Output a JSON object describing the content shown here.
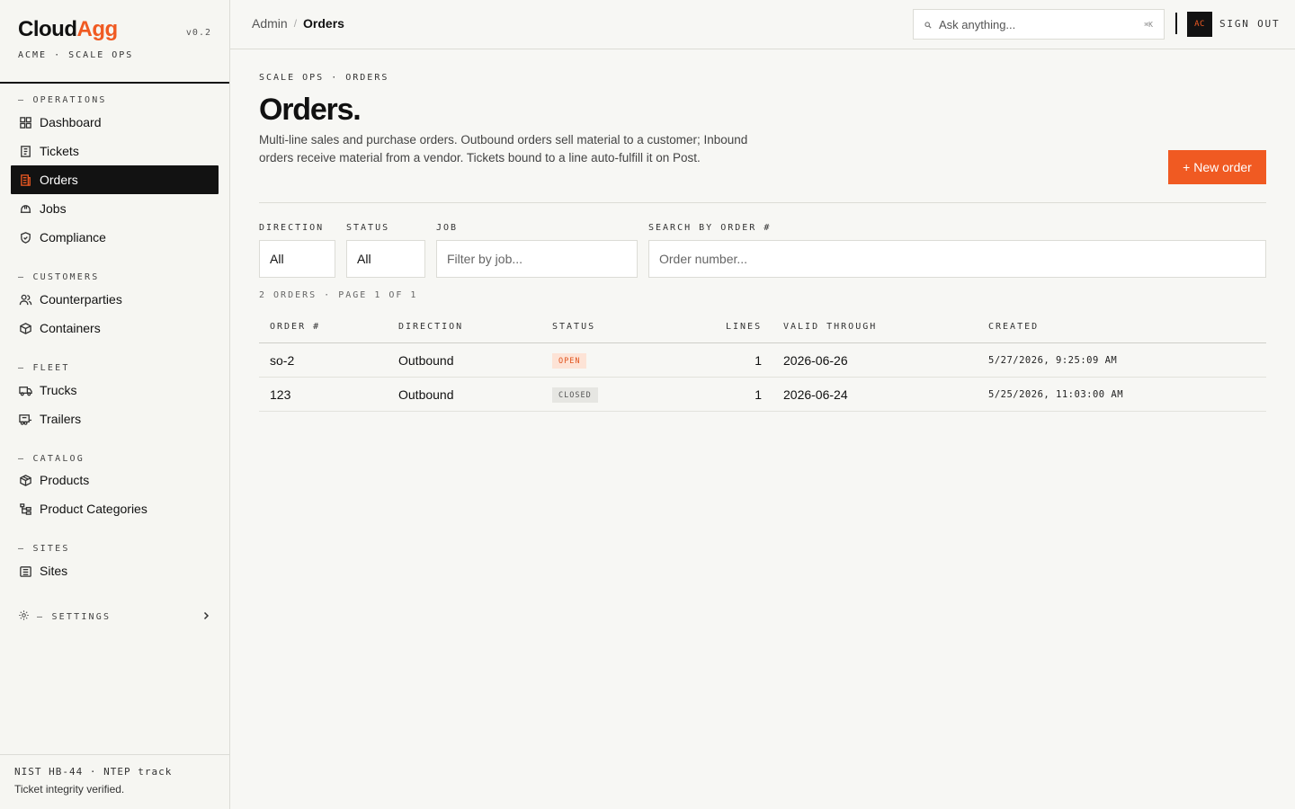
{
  "app": {
    "logo_part1": "Cloud",
    "logo_part2": "Agg",
    "version": "v0.2",
    "org": "ACME · SCALE OPS"
  },
  "sidebar": {
    "sections": [
      {
        "label": "— OPERATIONS",
        "items": [
          {
            "label": "Dashboard",
            "icon": "grid-icon"
          },
          {
            "label": "Tickets",
            "icon": "ticket-icon"
          },
          {
            "label": "Orders",
            "icon": "orders-icon",
            "active": true
          },
          {
            "label": "Jobs",
            "icon": "hardhat-icon"
          },
          {
            "label": "Compliance",
            "icon": "shield-icon"
          }
        ]
      },
      {
        "label": "— CUSTOMERS",
        "items": [
          {
            "label": "Counterparties",
            "icon": "users-icon"
          },
          {
            "label": "Containers",
            "icon": "box-icon"
          }
        ]
      },
      {
        "label": "— FLEET",
        "items": [
          {
            "label": "Trucks",
            "icon": "truck-icon"
          },
          {
            "label": "Trailers",
            "icon": "trailer-icon"
          }
        ]
      },
      {
        "label": "— CATALOG",
        "items": [
          {
            "label": "Products",
            "icon": "package-icon"
          },
          {
            "label": "Product Categories",
            "icon": "tree-icon"
          }
        ]
      },
      {
        "label": "— SITES",
        "items": [
          {
            "label": "Sites",
            "icon": "building-icon"
          }
        ]
      }
    ],
    "settings_label": "— SETTINGS",
    "footer_line1": "NIST HB-44 · NTEP track",
    "footer_line2": "Ticket integrity verified."
  },
  "topbar": {
    "breadcrumb_root": "Admin",
    "breadcrumb_sep": "/",
    "breadcrumb_current": "Orders",
    "ask_placeholder": "Ask anything...",
    "ask_shortcut": "⌘K",
    "avatar_initials": "AC",
    "signout_label": "SIGN OUT"
  },
  "page": {
    "eyebrow": "SCALE OPS · ORDERS",
    "title": "Orders.",
    "description": "Multi-line sales and purchase orders. Outbound orders sell material to a customer; Inbound orders receive material from a vendor. Tickets bound to a line auto-fulfill it on Post.",
    "new_button": "+ New order"
  },
  "filters": {
    "direction_label": "DIRECTION",
    "direction_value": "All",
    "status_label": "STATUS",
    "status_value": "All",
    "job_label": "JOB",
    "job_placeholder": "Filter by job...",
    "search_label": "SEARCH BY ORDER #",
    "search_placeholder": "Order number..."
  },
  "summary": "2 ORDERS · PAGE 1 OF 1",
  "table": {
    "columns": [
      "ORDER #",
      "DIRECTION",
      "STATUS",
      "LINES",
      "VALID THROUGH",
      "CREATED"
    ],
    "rows": [
      {
        "order": "so-2",
        "direction": "Outbound",
        "status": "OPEN",
        "lines": "1",
        "valid_through": "2026-06-26",
        "created": "5/27/2026, 9:25:09 AM"
      },
      {
        "order": "123",
        "direction": "Outbound",
        "status": "CLOSED",
        "lines": "1",
        "valid_through": "2026-06-24",
        "created": "5/25/2026, 11:03:00 AM"
      }
    ]
  },
  "colors": {
    "accent": "#f05a22",
    "active_nav_bg": "#121212",
    "open_badge_bg": "#fde3d6",
    "closed_badge_bg": "#e6e6e2"
  }
}
